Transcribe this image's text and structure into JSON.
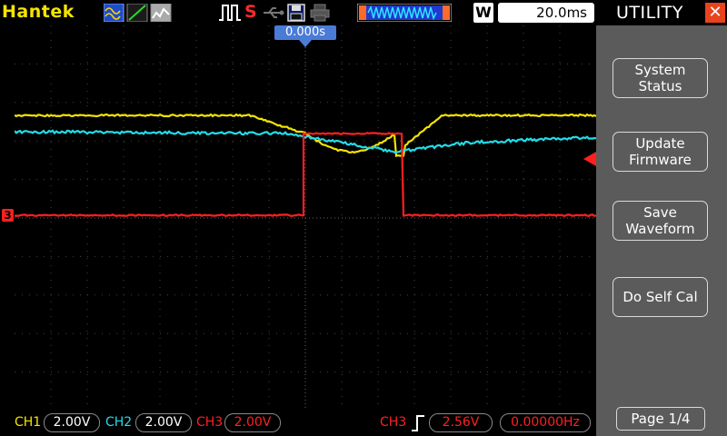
{
  "header": {
    "brand": "Hantek",
    "run_status": "S",
    "time_per_div": "20.0ms",
    "w_badge": "W",
    "trigger_time": "0.000s"
  },
  "channels": [
    {
      "label": "CH1",
      "volts_per_div": "2.00V",
      "color": "#f5e400"
    },
    {
      "label": "CH2",
      "volts_per_div": "2.00V",
      "color": "#22dcea"
    },
    {
      "label": "CH3",
      "volts_per_div": "2.00V",
      "color": "#ff2020"
    }
  ],
  "trigger": {
    "source": "CH3",
    "level": "2.56V",
    "frequency": "0.00000Hz"
  },
  "ch3_marker": "3",
  "menu": {
    "title": "UTILITY",
    "buttons": [
      {
        "label": "System\nStatus"
      },
      {
        "label": "Update\nFirmware"
      },
      {
        "label": "Save\nWaveform"
      },
      {
        "label": "Do Self Cal"
      }
    ],
    "page": "Page 1/4"
  },
  "colors": {
    "accent_header": "#4a7bd6",
    "menu_bg": "#5b5b5b",
    "close": "#e8431c"
  }
}
